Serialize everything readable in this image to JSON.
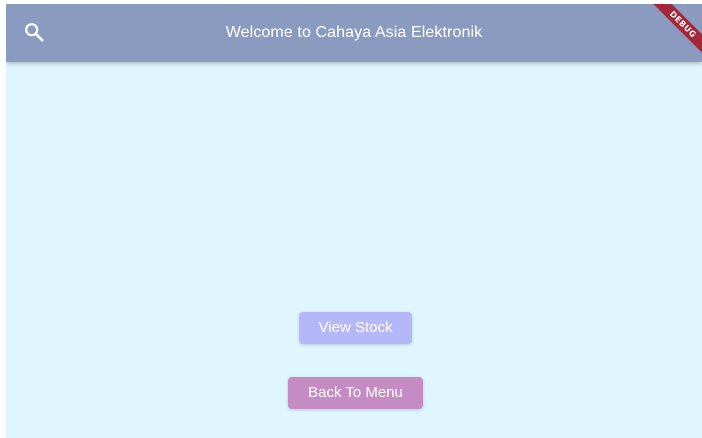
{
  "appbar": {
    "title": "Welcome to Cahaya Asia Elektronik",
    "search_icon": "search-icon",
    "background": "#8b9bc0"
  },
  "debug_banner": {
    "label": "DEBUG",
    "color": "#a5283a"
  },
  "main": {
    "background": "#dff6fe",
    "view_stock_label": "View Stock",
    "view_stock_color": "#b5b8f8",
    "back_to_menu_label": "Back To Menu",
    "back_to_menu_color": "#c58cc4"
  }
}
